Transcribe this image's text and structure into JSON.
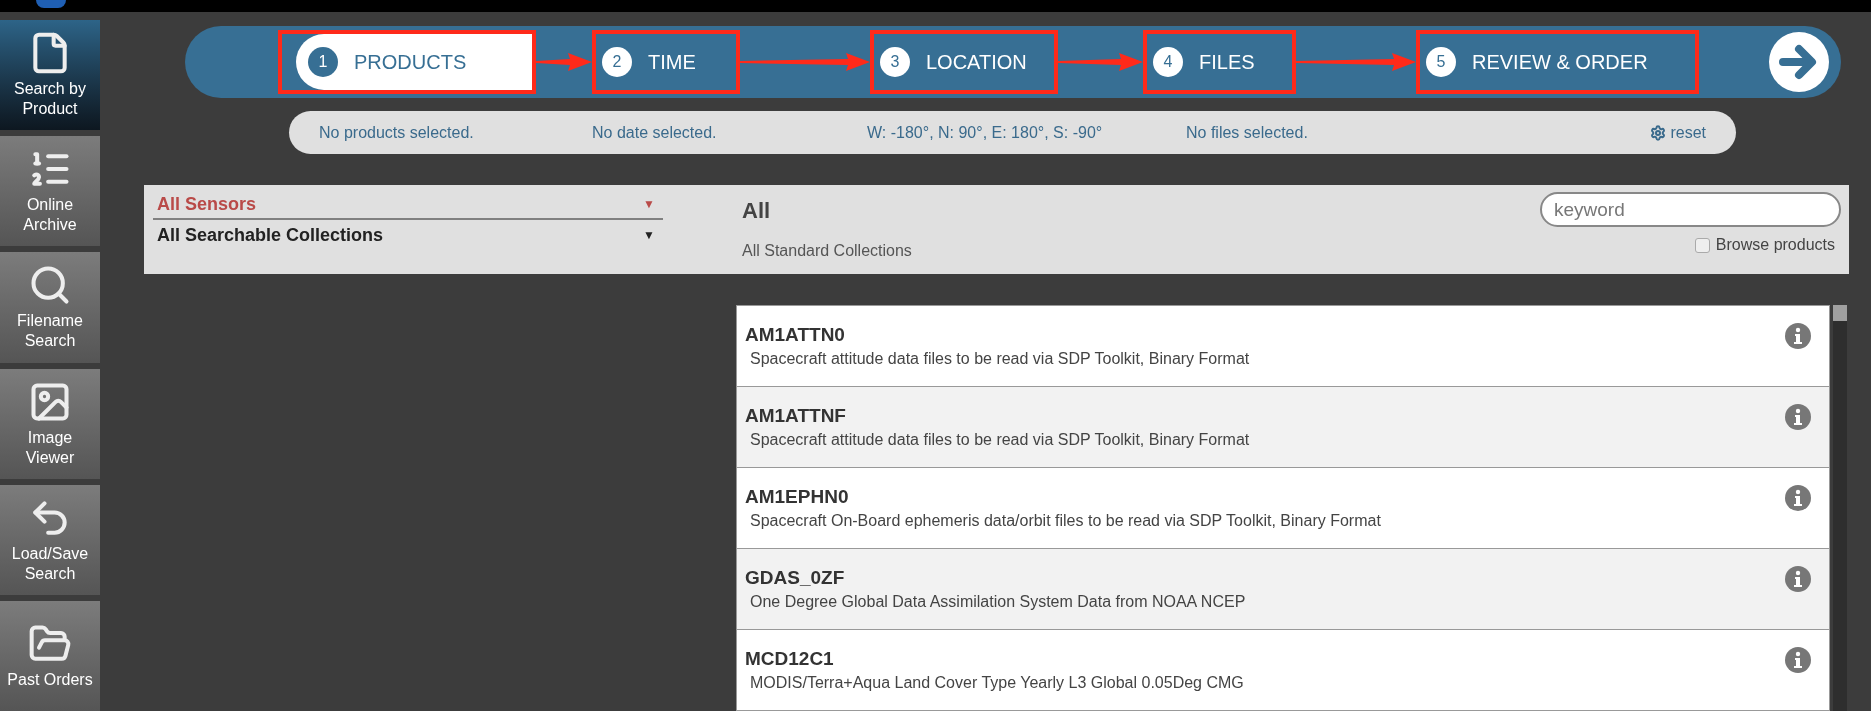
{
  "sidebar": {
    "items": [
      {
        "label": "Search by Product",
        "selected": true
      },
      {
        "label": "Online Archive",
        "selected": false
      },
      {
        "label": "Filename Search",
        "selected": false
      },
      {
        "label": "Image Viewer",
        "selected": false
      },
      {
        "label": "Load/Save Search",
        "selected": false
      },
      {
        "label": "Past Orders",
        "selected": false
      }
    ]
  },
  "steps": [
    {
      "number": "1",
      "label": "PRODUCTS",
      "selected": true,
      "highlighted": true
    },
    {
      "number": "2",
      "label": "TIME",
      "selected": false,
      "highlighted": true
    },
    {
      "number": "3",
      "label": "LOCATION",
      "selected": false,
      "highlighted": true
    },
    {
      "number": "4",
      "label": "FILES",
      "selected": false,
      "highlighted": true
    },
    {
      "number": "5",
      "label": "REVIEW & ORDER",
      "selected": false,
      "highlighted": true
    }
  ],
  "summary": {
    "products": "No products selected.",
    "date": "No date selected.",
    "location": "W: -180°, N: 90°, E: 180°, S: -90°",
    "files": "No files selected.",
    "reset": "reset"
  },
  "filters": {
    "sensor": "All Sensors",
    "collection": "All Searchable Collections",
    "caret": "▼",
    "heading": "All",
    "subheading": "All Standard Collections",
    "keyword": {
      "placeholder": "keyword"
    },
    "browse": {
      "label": "Browse products",
      "checked": false
    }
  },
  "products": [
    {
      "name": "AM1ATTN0",
      "description": "Spacecraft attitude data files to be read via SDP Toolkit, Binary Format"
    },
    {
      "name": "AM1ATTNF",
      "description": "Spacecraft attitude data files to be read via SDP Toolkit, Binary Format"
    },
    {
      "name": "AM1EPHN0",
      "description": "Spacecraft On-Board ephemeris data/orbit files to be read via SDP Toolkit, Binary Format"
    },
    {
      "name": "GDAS_0ZF",
      "description": "One Degree Global Data Assimilation System Data from NOAA NCEP"
    },
    {
      "name": "MCD12C1",
      "description": "MODIS/Terra+Aqua Land Cover Type Yearly L3 Global 0.05Deg CMG"
    }
  ]
}
